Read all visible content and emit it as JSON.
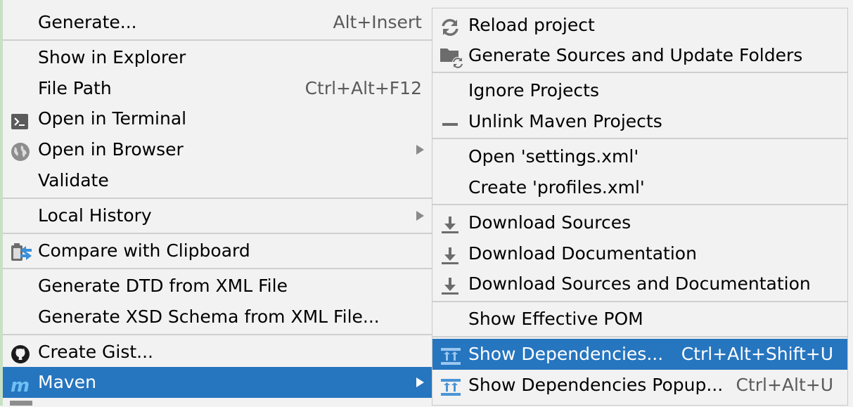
{
  "left_menu": {
    "items": [
      {
        "label": "Generate...",
        "shortcut": "Alt+Insert"
      },
      {
        "label": "Show in Explorer"
      },
      {
        "label": "File Path",
        "shortcut": "Ctrl+Alt+F12"
      },
      {
        "label": "Open in Terminal",
        "icon": "terminal-icon"
      },
      {
        "label": "Open in Browser",
        "icon": "globe-icon"
      },
      {
        "label": "Validate"
      },
      {
        "label": "Local History"
      },
      {
        "label": "Compare with Clipboard",
        "icon": "compare-clipboard-icon"
      },
      {
        "label": "Generate DTD from XML File"
      },
      {
        "label": "Generate XSD Schema from XML File..."
      },
      {
        "label": "Create Gist...",
        "icon": "github-icon"
      },
      {
        "label": "Maven",
        "icon": "maven-icon"
      }
    ]
  },
  "right_menu": {
    "items": [
      {
        "label": "Reload project",
        "icon": "reload-icon"
      },
      {
        "label": "Generate Sources and Update Folders",
        "icon": "folder-sync-icon"
      },
      {
        "label": "Ignore Projects"
      },
      {
        "label": "Unlink Maven Projects",
        "icon": "minus-icon"
      },
      {
        "label": "Open 'settings.xml'"
      },
      {
        "label": "Create 'profiles.xml'"
      },
      {
        "label": "Download Sources",
        "icon": "download-icon"
      },
      {
        "label": "Download Documentation",
        "icon": "download-icon"
      },
      {
        "label": "Download Sources and Documentation",
        "icon": "download-icon"
      },
      {
        "label": "Show Effective POM"
      },
      {
        "label": "Show Dependencies...",
        "shortcut": "Ctrl+Alt+Shift+U",
        "icon": "dependencies-icon"
      },
      {
        "label": "Show Dependencies Popup...",
        "shortcut": "Ctrl+Alt+U",
        "icon": "dependencies-icon"
      }
    ]
  },
  "colors": {
    "selection": "#2675bf",
    "background": "#f2f2f2",
    "separator": "#cfcfcf"
  }
}
